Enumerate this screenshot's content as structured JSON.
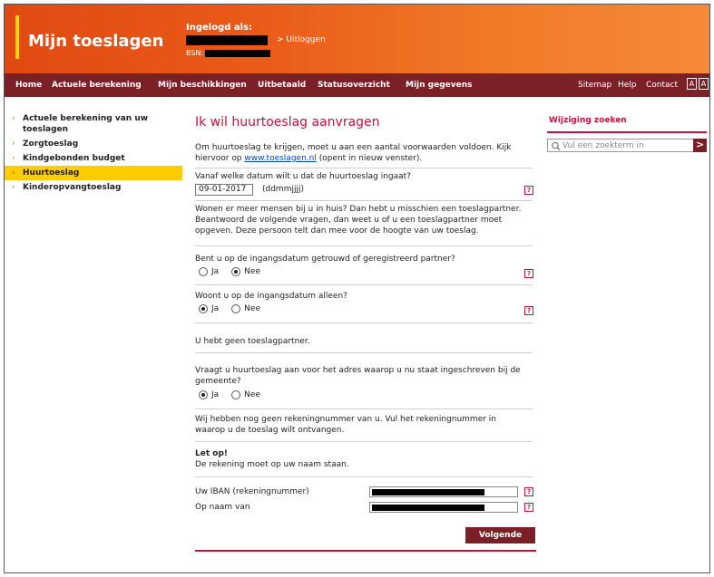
{
  "header": {
    "logo": "Mijn toeslagen",
    "login_label": "Ingelogd als:",
    "logout": "> Uitloggen",
    "bsn_label": "BSN:"
  },
  "nav": {
    "left": [
      "Home",
      "Actuele berekening",
      "Mijn beschikkingen",
      "Uitbetaald",
      "Statusoverzicht",
      "Mijn gegevens"
    ],
    "right": [
      "Sitemap",
      "Help",
      "Contact"
    ],
    "text_size_a": "A",
    "text_size_b": "A"
  },
  "sidebar": {
    "items": [
      {
        "label": "Actuele berekening van uw toeslagen",
        "active": false
      },
      {
        "label": "Zorgtoeslag",
        "active": false
      },
      {
        "label": "Kindgebonden budget",
        "active": false
      },
      {
        "label": "Huurtoeslag",
        "active": true
      },
      {
        "label": "Kinderopvangtoeslag",
        "active": false
      }
    ]
  },
  "main": {
    "title": "Ik wil huurtoeslag aanvragen",
    "intro_before_link": "Om huurtoeslag te krijgen, moet u aan een aantal voorwaarden voldoen. Kijk hiervoor op ",
    "intro_link": "www.toeslagen.nl",
    "intro_after_link": " (opent in nieuw venster).",
    "date_question": "Vanaf welke datum wilt u dat de huurtoeslag ingaat?",
    "date_value": "09-01-2017",
    "date_format": "(ddmmjjjj)",
    "partner_info": "Wonen er meer mensen bij u in huis? Dan hebt u misschien een toeslagpartner. Beantwoord de volgende vragen, dan weet u of u een toeslagpartner moet opgeven. Deze persoon telt dan mee voor de hoogte van uw toeslag.",
    "q_married": "Bent u op de ingangsdatum getrouwd of geregistreerd partner?",
    "q_alone": "Woont u op de ingangsdatum alleen?",
    "no_partner": "U hebt geen toeslagpartner.",
    "q_address": "Vraagt u huurtoeslag aan voor het adres waarop u nu staat ingeschreven bij de gemeente?",
    "yes": "Ja",
    "no": "Nee",
    "account_info": "Wij hebben nog geen rekeningnummer van u. Vul het rekeningnummer in waarop u de toeslag wilt ontvangen.",
    "attention_title": "Let op!",
    "attention_text": "De rekening moet op uw naam staan.",
    "iban_label": "Uw IBAN (rekeningnummer)",
    "name_label": "Op naam van",
    "help_glyph": "?",
    "next_button": "Volgende"
  },
  "right": {
    "title": "Wijziging zoeken",
    "search_placeholder": "Vul een zoekterm in",
    "search_button": ">"
  },
  "answers": {
    "married": "Nee",
    "alone": "Ja",
    "address": "Ja"
  }
}
